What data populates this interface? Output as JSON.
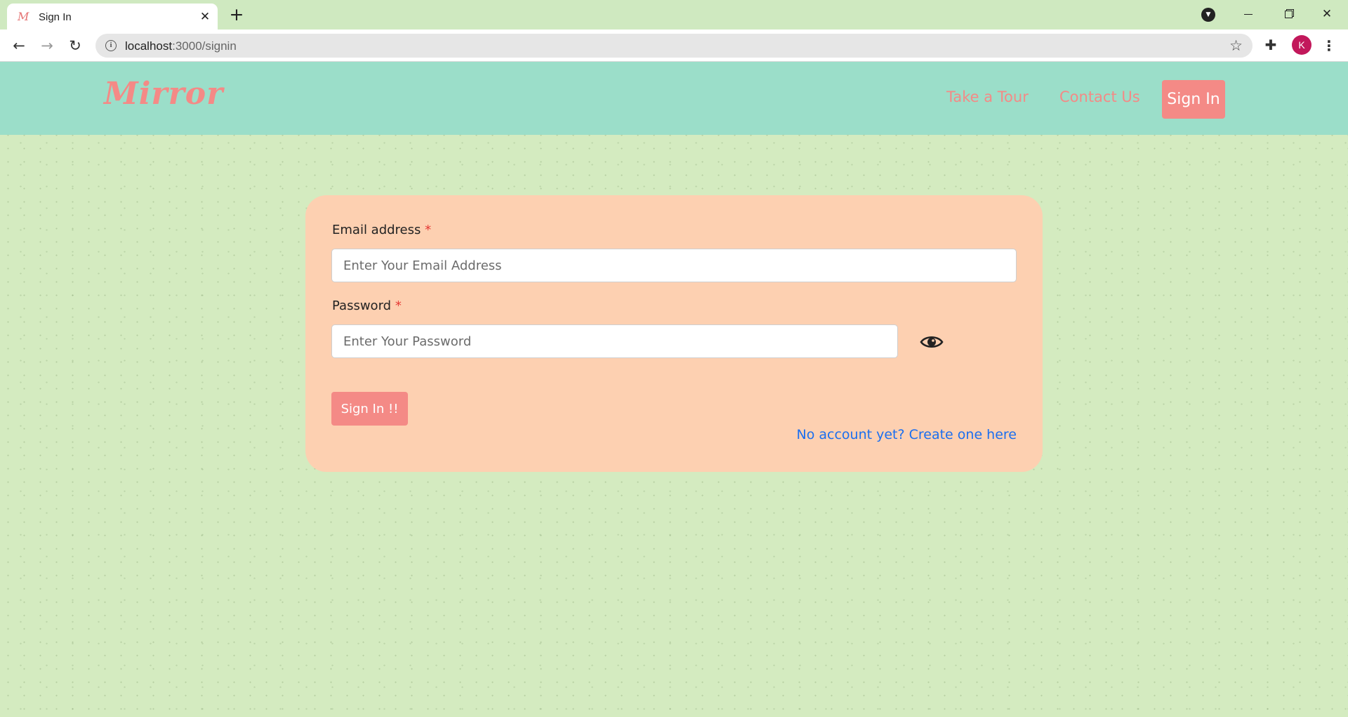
{
  "browser": {
    "tab_title": "Sign In",
    "tab_favicon": "M",
    "url_host": "localhost",
    "url_path": ":3000/signin",
    "profile_initial": "K"
  },
  "navbar": {
    "brand": "Mirror",
    "links": [
      "Take a Tour",
      "Contact Us"
    ],
    "signin_label": "Sign In"
  },
  "form": {
    "email_label": "Email address",
    "email_placeholder": "Enter Your Email Address",
    "password_label": "Password",
    "password_placeholder": "Enter Your Password",
    "required_mark": "*",
    "submit_label": "Sign In !!",
    "create_account_link": "No account yet? Create one here"
  },
  "colors": {
    "navbar_bg": "#9bdec9",
    "page_bg": "#d4ebc0",
    "card_bg": "#fdd0b1",
    "accent": "#f48a86",
    "link": "#1a6ef0",
    "required": "#e53935"
  },
  "icons": [
    "info-icon",
    "star-icon",
    "puzzle-icon",
    "menu-dots-icon",
    "eye-icon",
    "close-icon",
    "plus-icon",
    "back-arrow-icon",
    "forward-arrow-icon",
    "reload-icon"
  ]
}
